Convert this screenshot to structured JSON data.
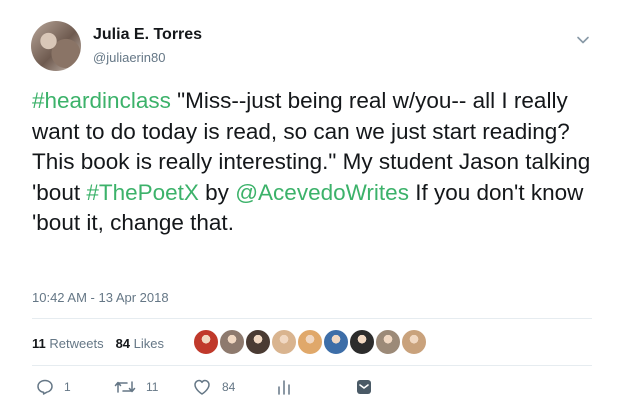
{
  "author": {
    "name": "Julia E. Torres",
    "handle": "@juliaerin80"
  },
  "tweet": {
    "segments": [
      {
        "text": "#heardinclass",
        "link": true
      },
      {
        "text": " \"Miss--just being real w/you-- all I really want to do today is read, so can we just start reading?  This book is really interesting.\" My student Jason talking 'bout ",
        "link": false
      },
      {
        "text": "#ThePoetX",
        "link": true
      },
      {
        "text": " by ",
        "link": false
      },
      {
        "text": "@AcevedoWrites",
        "link": true
      },
      {
        "text": " If you don't know 'bout it, change that.",
        "link": false
      }
    ]
  },
  "timestamp": "10:42 AM - 13 Apr 2018",
  "stats": {
    "retweets_count": "11",
    "retweets_label": "Retweets",
    "likes_count": "84",
    "likes_label": "Likes"
  },
  "likers": [
    {
      "icon": "liker-avatar",
      "color": "#c0392b"
    },
    {
      "icon": "liker-avatar",
      "color": "#8e7a6e"
    },
    {
      "icon": "liker-avatar",
      "color": "#4a3b33"
    },
    {
      "icon": "liker-avatar",
      "color": "#d9b48f"
    },
    {
      "icon": "liker-avatar",
      "color": "#e0a86a"
    },
    {
      "icon": "liker-avatar",
      "color": "#3d6ea8"
    },
    {
      "icon": "liker-avatar",
      "color": "#2c2c2c"
    },
    {
      "icon": "liker-avatar",
      "color": "#9c8a78"
    },
    {
      "icon": "liker-avatar",
      "color": "#c9a27c"
    }
  ],
  "actions": {
    "reply_count": "1",
    "retweet_count": "11",
    "like_count": "84"
  },
  "colors": {
    "link": "#3cb26a",
    "muted": "#657786",
    "text": "#14171a"
  }
}
